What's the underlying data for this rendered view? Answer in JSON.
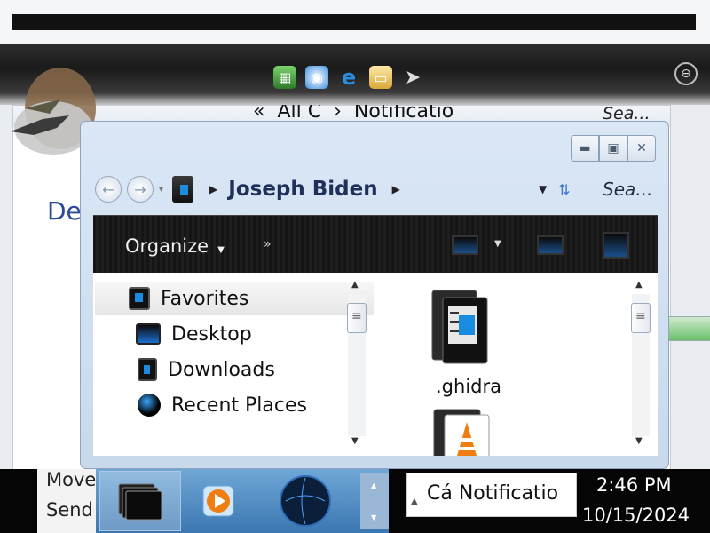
{
  "background": {
    "back_window": {
      "breadcrumb": [
        "All C",
        "Notificatio"
      ],
      "search_placeholder": "Sea...",
      "partial_heading": "De"
    },
    "quick_launch": [
      "green-app-icon",
      "globe-icon",
      "internet-explorer-icon",
      "folder-icon",
      "bird-cursor-icon"
    ]
  },
  "explorer": {
    "breadcrumb": {
      "user": "Joseph Biden"
    },
    "search_placeholder": "Sea...",
    "toolbar": {
      "organize_label": "Organize",
      "more_label": "»"
    },
    "nav_pane": {
      "items": [
        {
          "label": "Favorites",
          "icon": "favorites-icon"
        },
        {
          "label": "Desktop",
          "icon": "desktop-icon"
        },
        {
          "label": "Downloads",
          "icon": "downloads-icon"
        },
        {
          "label": "Recent Places",
          "icon": "recent-places-icon"
        }
      ]
    },
    "files": [
      {
        "label": ".ghidra",
        "icon": "folder-icon"
      },
      {
        "label": "",
        "icon": "vlc-folder-icon"
      }
    ]
  },
  "taskbar": {
    "menu_items": [
      "Move",
      "Send"
    ],
    "tray_popup_text": "Cá Notificatio",
    "clock_time": "2:46 PM",
    "clock_date": "10/15/2024"
  },
  "colors": {
    "accent": "#1a8ce0",
    "breadcrumb_text": "#1f2f5a",
    "back_heading": "#2b4b9a"
  }
}
